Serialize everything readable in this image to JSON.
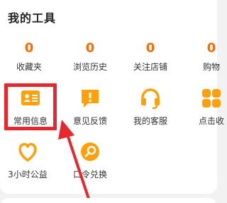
{
  "section": {
    "title": "我的工具"
  },
  "stats": [
    {
      "value": "0",
      "label": "收藏夹"
    },
    {
      "value": "0",
      "label": "浏览历史"
    },
    {
      "value": "0",
      "label": "关注店铺"
    },
    {
      "value": "0",
      "label": "购物"
    }
  ],
  "tools_row1": [
    {
      "label": "常用信息",
      "icon": "id-card-icon",
      "color": "#ff9f0a"
    },
    {
      "label": "意见反馈",
      "icon": "feedback-icon",
      "color": "#ff9f0a"
    },
    {
      "label": "我的客服",
      "icon": "headset-icon",
      "color": "#ff9f0a"
    },
    {
      "label": "点击收",
      "icon": "grid-icon",
      "color": "#ff9f0a"
    }
  ],
  "tools_row2": [
    {
      "label": "3小时公益",
      "icon": "heart-hands-icon",
      "color": "#ff9f0a"
    },
    {
      "label": "口令兑换",
      "icon": "key-code-icon",
      "color": "#ff9f0a"
    }
  ],
  "accent": "#ff6a00",
  "highlight_color": "#e8262d"
}
